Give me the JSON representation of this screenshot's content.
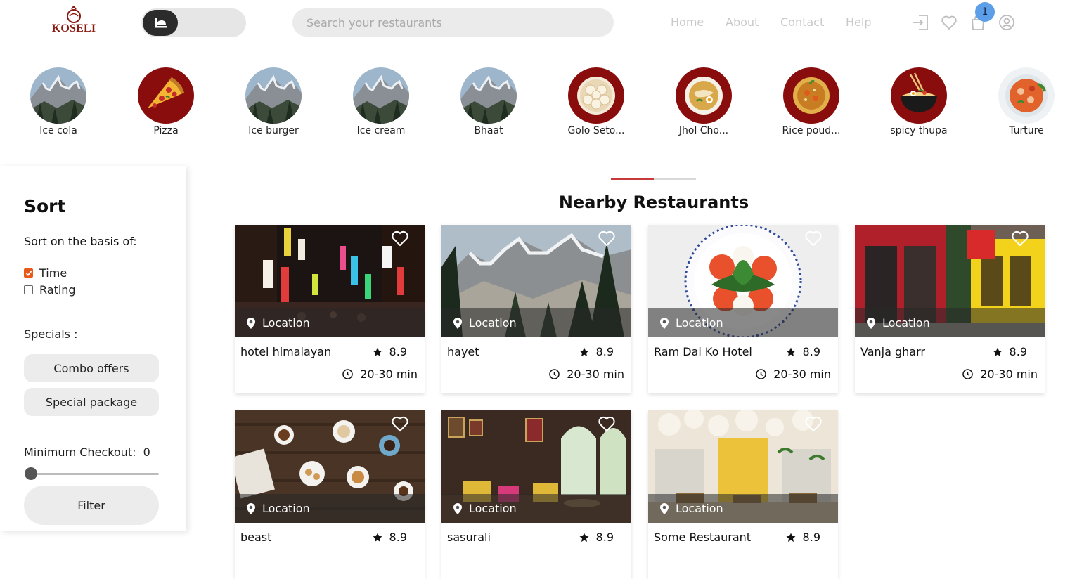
{
  "brand": {
    "name": "KOSELI",
    "color": "#8b1a12"
  },
  "search": {
    "placeholder": "Search your restaurants"
  },
  "nav": [
    {
      "label": "Home"
    },
    {
      "label": "About"
    },
    {
      "label": "Contact"
    },
    {
      "label": "Help"
    }
  ],
  "header_icons": [
    "login-icon",
    "heart-icon",
    "cart-icon",
    "user-icon"
  ],
  "cart": {
    "count": "1"
  },
  "categories": [
    {
      "label": "Ice cola",
      "icon": "mountain-photo"
    },
    {
      "label": "Pizza",
      "icon": "pizza-slice"
    },
    {
      "label": "Ice burger",
      "icon": "mountain-photo"
    },
    {
      "label": "Ice cream",
      "icon": "mountain-photo"
    },
    {
      "label": "Bhaat",
      "icon": "mountain-photo"
    },
    {
      "label": "Golo Seto...",
      "icon": "momo-plate"
    },
    {
      "label": "Jhol Cho...",
      "icon": "soup-bowl"
    },
    {
      "label": "Rice poud...",
      "icon": "rice-plate"
    },
    {
      "label": "spicy thupa",
      "icon": "noodle-bowl"
    },
    {
      "label": "Turture",
      "icon": "stew-plate"
    }
  ],
  "sidebar": {
    "title": "Sort",
    "subtitle": "Sort on the basis of:",
    "options": [
      {
        "label": "Time",
        "checked": true
      },
      {
        "label": "Rating",
        "checked": false
      }
    ],
    "specials_label": "Specials :",
    "specials": [
      {
        "label": "Combo offers"
      },
      {
        "label": "Special package"
      }
    ],
    "min_checkout_label": "Minimum Checkout:",
    "min_checkout_value": "0",
    "filter_label": "Filter"
  },
  "section": {
    "title": "Nearby Restaurants"
  },
  "restaurants": [
    {
      "name": "hotel himalayan",
      "rating": "8.9",
      "time": "20-30 min",
      "location": "Location",
      "image": "night-street"
    },
    {
      "name": "hayet",
      "rating": "8.9",
      "time": "20-30 min",
      "location": "Location",
      "image": "snowy-mountain"
    },
    {
      "name": "Ram Dai Ko Hotel",
      "rating": "8.9",
      "time": "20-30 min",
      "location": "Location",
      "image": "caprese-plate"
    },
    {
      "name": "Vanja gharr",
      "rating": "8.9",
      "time": "20-30 min",
      "location": "Location",
      "image": "shopfront"
    },
    {
      "name": "beast",
      "rating": "8.9",
      "location": "Location",
      "image": "cafe-table"
    },
    {
      "name": "sasurali",
      "rating": "8.9",
      "location": "Location",
      "image": "vintage-interior"
    },
    {
      "name": "Some Restaurant",
      "rating": "8.9",
      "location": "Location",
      "image": "bright-interior"
    }
  ],
  "colors": {
    "accent": "#e8591a",
    "badge": "#5c9fe8",
    "divider": "#c73a3a",
    "nav": "#c9c9c9"
  }
}
